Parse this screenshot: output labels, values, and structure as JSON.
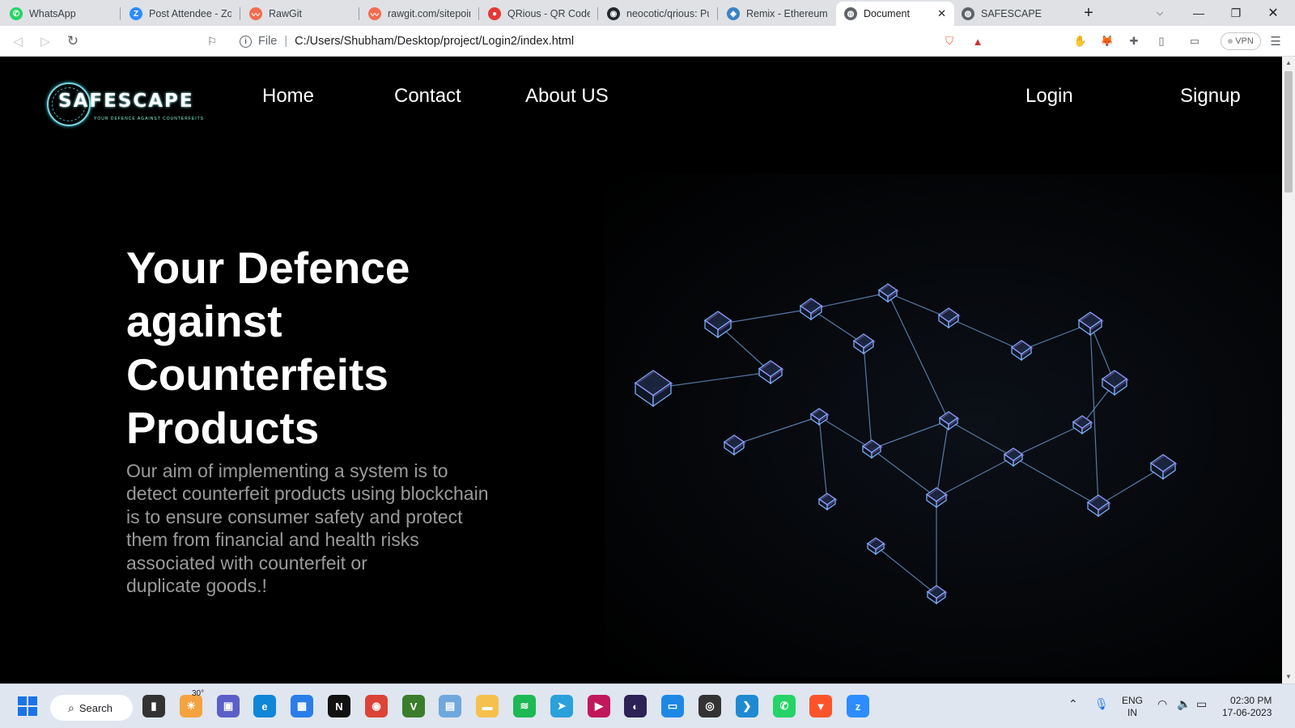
{
  "browser": {
    "tabs": [
      {
        "label": "WhatsApp",
        "icon": "whatsapp-icon",
        "color": "#25d366",
        "glyph": "✆"
      },
      {
        "label": "Post Attendee - Zoo",
        "icon": "zoom-icon",
        "color": "#2d8cff",
        "glyph": "Z"
      },
      {
        "label": "RawGit",
        "icon": "rawgit-icon",
        "color": "#f26d4f",
        "glyph": "〰"
      },
      {
        "label": "rawgit.com/sitepoin",
        "icon": "rawgit-icon",
        "color": "#f26d4f",
        "glyph": "〰"
      },
      {
        "label": "QRious - QR Code C",
        "icon": "qrious-icon",
        "color": "#e53935",
        "glyph": "●"
      },
      {
        "label": "neocotic/qrious: Pu",
        "icon": "github-icon",
        "color": "#24292e",
        "glyph": "◉"
      },
      {
        "label": "Remix - Ethereum ID",
        "icon": "remix-icon",
        "color": "#3b82c4",
        "glyph": "◈"
      },
      {
        "label": "Document",
        "icon": "globe-icon",
        "color": "#5f6368",
        "glyph": "◍"
      },
      {
        "label": "SAFESCAPE",
        "icon": "globe-icon",
        "color": "#5f6368",
        "glyph": "◍"
      }
    ],
    "active_tab": "Document",
    "address": {
      "scheme_label": "File",
      "url": "C:/Users/Shubham/Desktop/project/Login2/index.html"
    },
    "vpn_label": "VPN"
  },
  "site": {
    "logo_text": "SAFESCAPE",
    "logo_tagline": "YOUR DEFENCE AGAINST COUNTERFEITS",
    "nav": {
      "home": "Home",
      "contact": "Contact",
      "about": "About US",
      "login": "Login",
      "signup": "Signup"
    },
    "hero": {
      "title_lines": [
        "Your Defence",
        "against",
        "Counterfeits",
        "Products"
      ],
      "text_lines": [
        "Our aim of implementing a system is to",
        "detect counterfeit products using blockchain",
        "is to ensure consumer safety and protect",
        "them from financial and health risks",
        "associated with counterfeit or",
        "duplicate goods.!"
      ]
    }
  },
  "taskbar": {
    "search_label": "Search",
    "weather": "30°",
    "language": "ENG",
    "region": "IN",
    "time": "02:30 PM",
    "date": "17-06-2023",
    "apps": [
      {
        "name": "file-explorer-icon",
        "color": "#333",
        "glyph": "▮"
      },
      {
        "name": "weather-icon",
        "color": "#f4a340",
        "glyph": "☀"
      },
      {
        "name": "teams-icon",
        "color": "#5b5fc7",
        "glyph": "▣"
      },
      {
        "name": "edge-icon",
        "color": "#0f86d8",
        "glyph": "e"
      },
      {
        "name": "store-icon",
        "color": "#2b7de9",
        "glyph": "▦"
      },
      {
        "name": "netflix-icon",
        "color": "#111",
        "glyph": "N"
      },
      {
        "name": "chrome-icon",
        "color": "#db4437",
        "glyph": "◉"
      },
      {
        "name": "vim-icon",
        "color": "#3a7d2c",
        "glyph": "V"
      },
      {
        "name": "photos-icon",
        "color": "#6fa8dc",
        "glyph": "▤"
      },
      {
        "name": "folder-icon",
        "color": "#f6c04c",
        "glyph": "▬"
      },
      {
        "name": "spotify-icon",
        "color": "#1db954",
        "glyph": "≋"
      },
      {
        "name": "telegram-icon",
        "color": "#2aa1da",
        "glyph": "➤"
      },
      {
        "name": "media-player-icon",
        "color": "#c2185b",
        "glyph": "▶"
      },
      {
        "name": "eclipse-icon",
        "color": "#2c2255",
        "glyph": "◐"
      },
      {
        "name": "remote-desktop-icon",
        "color": "#1e88e5",
        "glyph": "▭"
      },
      {
        "name": "github-desktop-icon",
        "color": "#333",
        "glyph": "◎"
      },
      {
        "name": "vscode-icon",
        "color": "#1f8ad2",
        "glyph": "❯"
      },
      {
        "name": "whatsapp-icon",
        "color": "#25d366",
        "glyph": "✆"
      },
      {
        "name": "brave-icon",
        "color": "#fb542b",
        "glyph": "▼"
      },
      {
        "name": "zoom-icon",
        "color": "#2d8cff",
        "glyph": "z"
      }
    ]
  }
}
